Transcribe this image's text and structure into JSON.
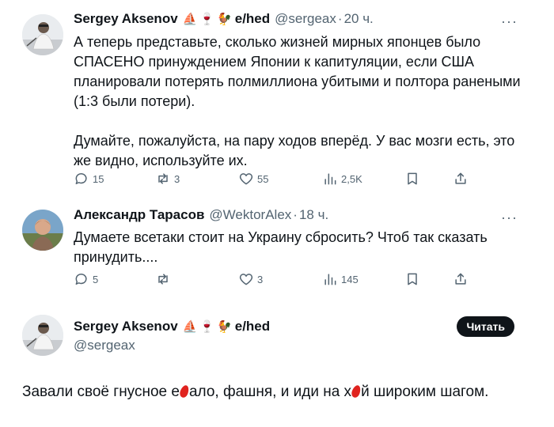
{
  "tweets": [
    {
      "name": "Sergey Aksenov",
      "badges": [
        "⛵",
        "🍷",
        "🐓"
      ],
      "badge_names": [
        "sailboat-emoji",
        "wine-glass-emoji",
        "rooster-emoji"
      ],
      "suffix": "e/hed",
      "handle": "@sergeax",
      "dot": "·",
      "time": "20 ч.",
      "more": "···",
      "text": "А теперь представьте, сколько жизней мирных японцев было СПАСЕНО принуждением Японии к капитуляции, если США планировали потерять полмиллиона убитыми и полтора ранеными (1:3 были потери).\n\nДумайте, пожалуйста, на пару ходов вперёд. У вас мозги есть, это же видно, используйте их.",
      "actions": {
        "replies": "15",
        "reposts": "3",
        "likes": "55",
        "views": "2,5K"
      }
    },
    {
      "name": "Александр Тарасов",
      "handle": "@WektorAlex",
      "dot": "·",
      "time": "18 ч.",
      "more": "···",
      "text": "Думаете всетаки стоит на Украину сбросить? Чтоб так сказать принудить....",
      "actions": {
        "replies": "5",
        "reposts": "",
        "likes": "3",
        "views": "145"
      }
    }
  ],
  "main_tweet": {
    "name": "Sergey Aksenov",
    "badges": [
      "⛵",
      "🍷",
      "🐓"
    ],
    "suffix": "e/hed",
    "handle": "@sergeax",
    "follow_label": "Читать",
    "text_part1": "Завали своё гнусное е",
    "text_part2": "ало, фашня, и иди на х",
    "text_part3": "й широким шагом.",
    "redaction_color": "#e0231f"
  },
  "colors": {
    "primary_text": "#0f1419",
    "secondary_text": "#536471",
    "button_bg": "#0f1419"
  }
}
